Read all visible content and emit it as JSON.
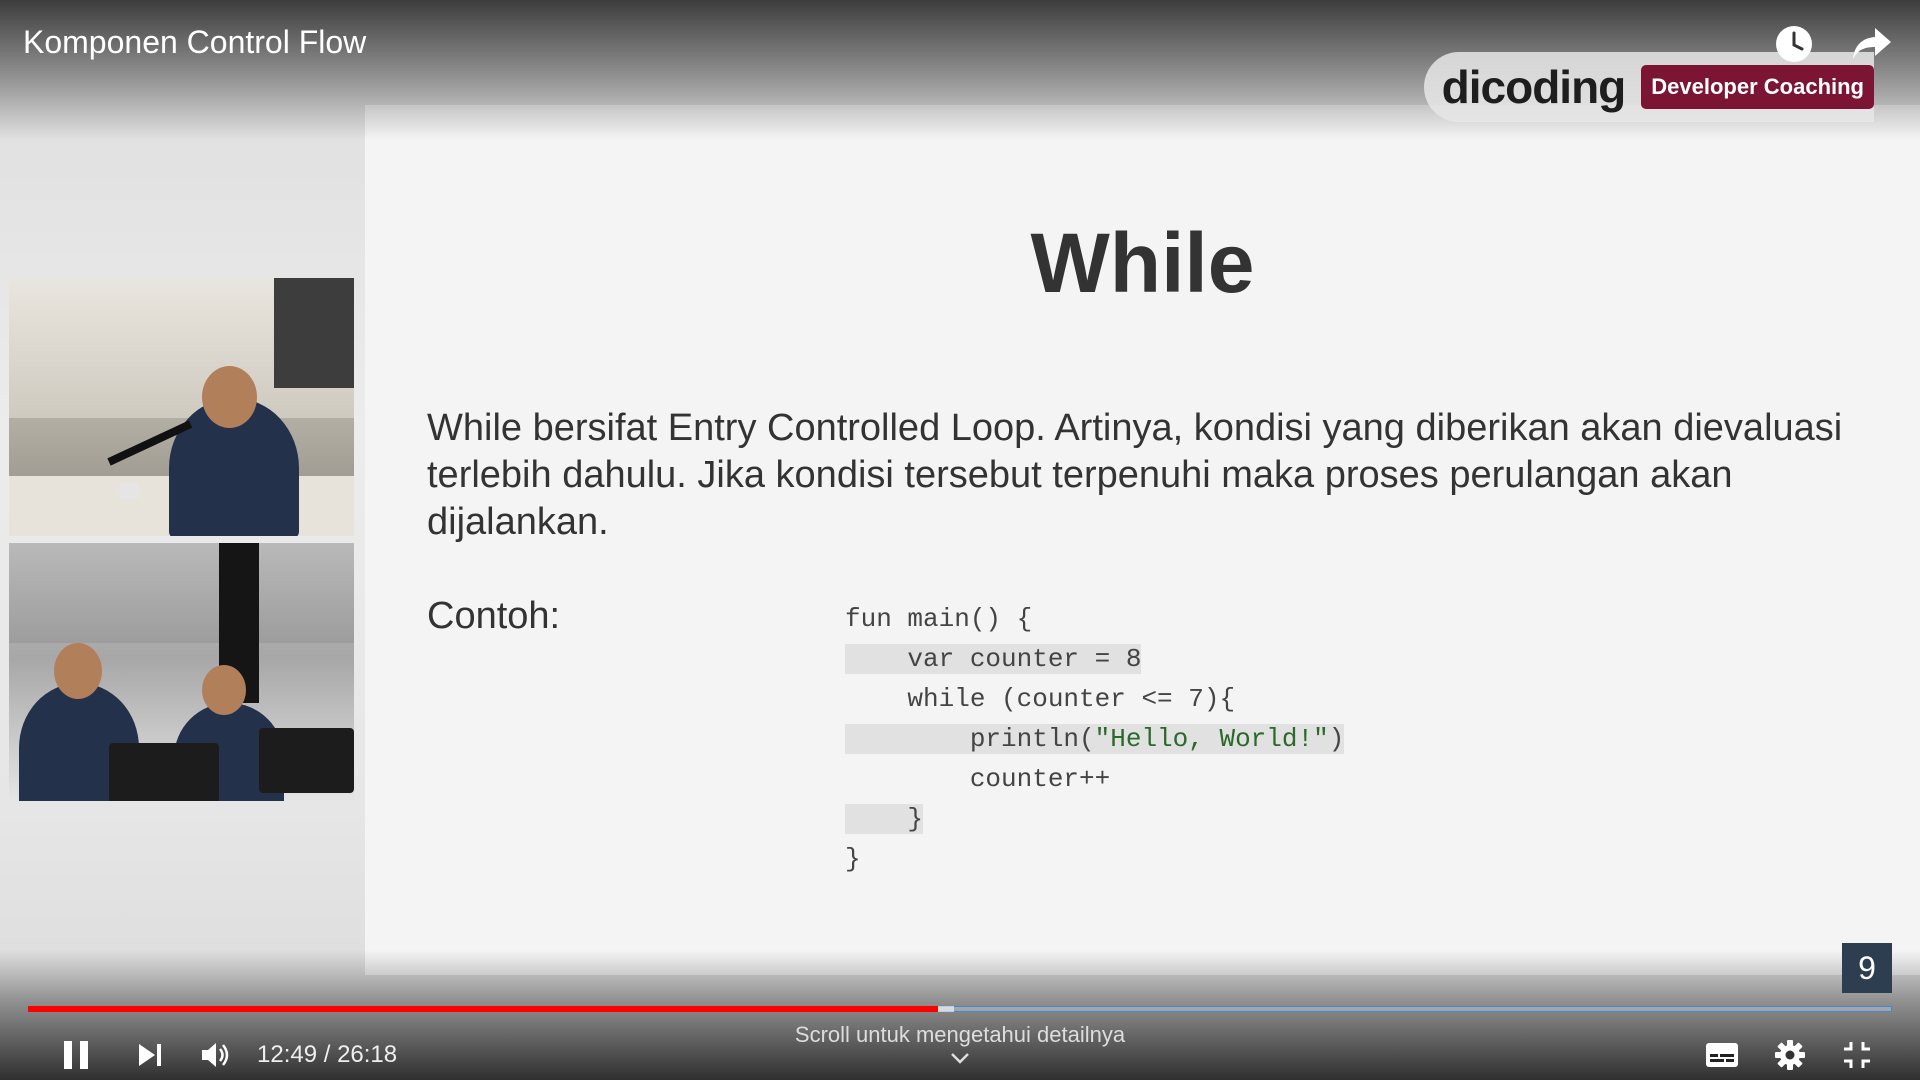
{
  "video": {
    "title": "Komponen Control Flow"
  },
  "top_icons": [
    {
      "name": "watch-later-icon"
    },
    {
      "name": "share-icon"
    }
  ],
  "brand": {
    "logo": "dicoding",
    "badge": "Developer Coaching",
    "badge_color": "#7c1434"
  },
  "slide": {
    "title": "While",
    "body": "While bersifat Entry Controlled Loop. Artinya, kondisi yang diberikan akan dievaluasi terlebih dahulu. Jika kondisi tersebut terpenuhi maka proses perulangan akan dijalankan.",
    "example_label": "Contoh:",
    "code": {
      "line1": "fun main() {",
      "line2": "    var counter = 8",
      "line3": "    while (counter <= 7){",
      "line4a": "        println(",
      "line4b": "\"Hello, World!\"",
      "line4c": ")",
      "line5": "        counter++",
      "line6": "    }",
      "line7": "}"
    },
    "page_number": "9"
  },
  "player": {
    "progress_fraction": 0.488,
    "buffer_fraction": 0.497,
    "current_time": "12:49",
    "duration": "26:18",
    "time_display": "12:49 / 26:18",
    "scroll_hint": "Scroll untuk mengetahui detailnya",
    "played_color": "#ff0000"
  }
}
